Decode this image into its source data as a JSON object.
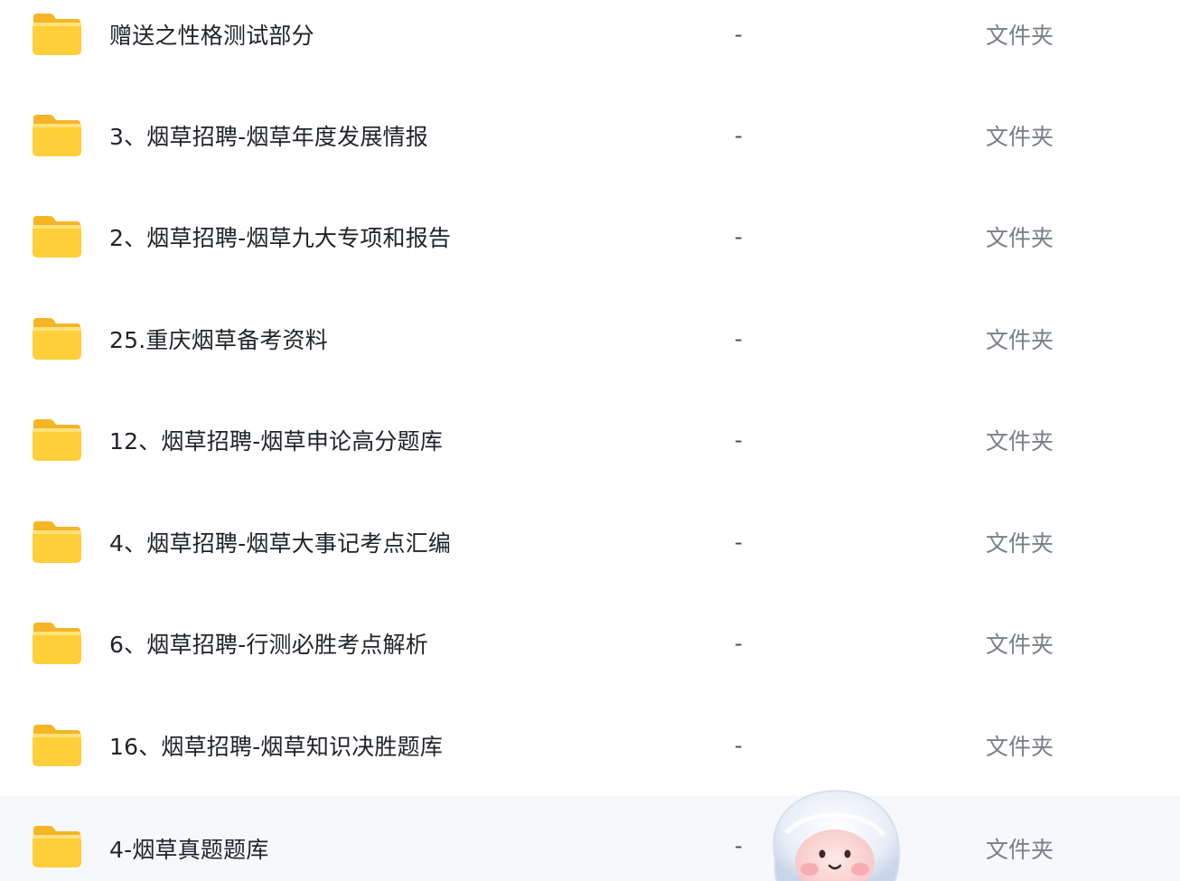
{
  "file_list": {
    "rows": [
      {
        "name": "赠送之性格测试部分",
        "size": "-",
        "type": "文件夹"
      },
      {
        "name": "3、烟草招聘-烟草年度发展情报",
        "size": "-",
        "type": "文件夹"
      },
      {
        "name": "2、烟草招聘-烟草九大专项和报告",
        "size": "-",
        "type": "文件夹"
      },
      {
        "name": "25.重庆烟草备考资料",
        "size": "-",
        "type": "文件夹"
      },
      {
        "name": "12、烟草招聘-烟草申论高分题库",
        "size": "-",
        "type": "文件夹"
      },
      {
        "name": "4、烟草招聘-烟草大事记考点汇编",
        "size": "-",
        "type": "文件夹"
      },
      {
        "name": "6、烟草招聘-行测必胜考点解析",
        "size": "-",
        "type": "文件夹"
      },
      {
        "name": "16、烟草招聘-烟草知识决胜题库",
        "size": "-",
        "type": "文件夹"
      },
      {
        "name": "4-烟草真题题库",
        "size": "-",
        "type": "文件夹"
      }
    ],
    "icon": "folder-icon",
    "colors": {
      "folder_yellow": "#ffcf3a",
      "folder_back": "#f5b524",
      "hover_row": "#f7f8fc"
    }
  },
  "assistant": {
    "icon": "mascot-icon"
  }
}
